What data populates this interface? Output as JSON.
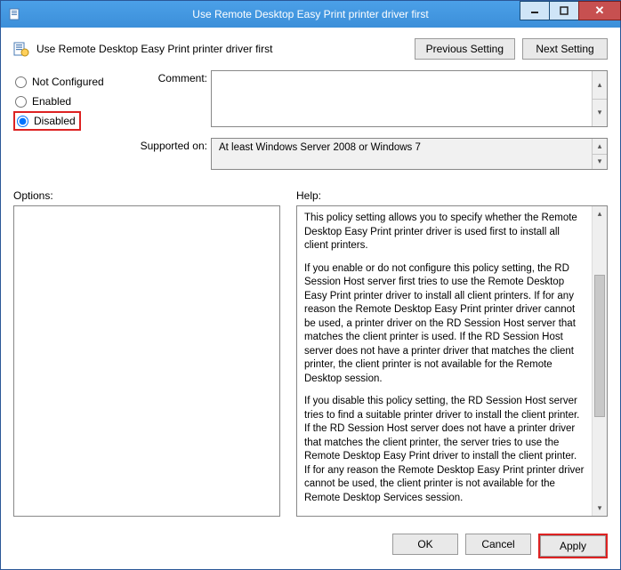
{
  "titlebar": {
    "title": "Use Remote Desktop Easy Print printer driver first"
  },
  "header": {
    "policy_title": "Use Remote Desktop Easy Print printer driver first",
    "prev_label": "Previous Setting",
    "next_label": "Next Setting"
  },
  "state": {
    "not_configured": "Not Configured",
    "enabled": "Enabled",
    "disabled": "Disabled",
    "selected": "disabled"
  },
  "meta": {
    "comment_label": "Comment:",
    "comment_value": "",
    "supported_label": "Supported on:",
    "supported_value": "At least Windows Server 2008 or Windows 7"
  },
  "labels": {
    "options": "Options:",
    "help": "Help:"
  },
  "help": {
    "p1": "This policy setting allows you to specify whether the Remote Desktop Easy Print printer driver is used first to install all client printers.",
    "p2": "If you enable or do not configure this policy setting, the RD Session Host server first tries to use the Remote Desktop Easy Print printer driver to install all client printers. If for any reason the Remote Desktop Easy Print printer driver cannot be used, a printer driver on the RD Session Host server that matches the client printer is used. If the RD Session Host server does not have a printer driver that matches the client printer, the client printer is not available for the Remote Desktop session.",
    "p3": "If you disable this policy setting, the RD Session Host server tries to find a suitable printer driver to install the client printer. If the RD Session Host server does not have a printer driver that matches the client printer, the server tries to use the Remote Desktop Easy Print driver to install the client printer. If for any reason the Remote Desktop Easy Print printer driver cannot be used, the client printer is not available for the Remote Desktop Services session."
  },
  "footer": {
    "ok": "OK",
    "cancel": "Cancel",
    "apply": "Apply"
  }
}
